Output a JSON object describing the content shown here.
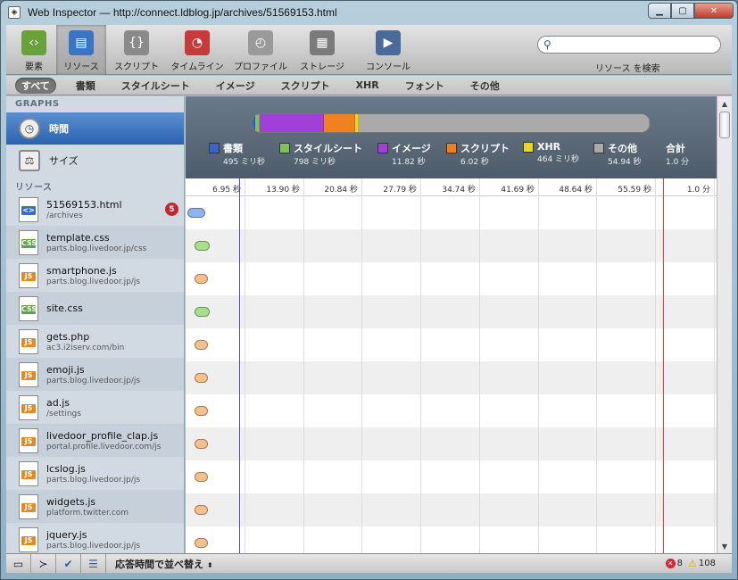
{
  "window": {
    "title": "Web Inspector — http://connect.ldblog.jp/archives/51569153.html"
  },
  "toolbar": {
    "tools": [
      {
        "label": "要素",
        "icon": "elements-icon",
        "color": "#6aa23a"
      },
      {
        "label": "リソース",
        "icon": "resources-icon",
        "color": "#3a74c4"
      },
      {
        "label": "スクリプト",
        "icon": "scripts-icon",
        "color": "#8a8a8a"
      },
      {
        "label": "タイムライン",
        "icon": "timeline-icon",
        "color": "#c83a3a"
      },
      {
        "label": "プロファイル",
        "icon": "profiles-icon",
        "color": "#9a9a9a"
      },
      {
        "label": "ストレージ",
        "icon": "storage-icon",
        "color": "#7a7a7a"
      },
      {
        "label": "コンソール",
        "icon": "console-icon",
        "color": "#4a6a9a"
      }
    ],
    "search_placeholder": "",
    "search_label": "リソース を検索"
  },
  "scopes": [
    "すべて",
    "書類",
    "スタイルシート",
    "イメージ",
    "スクリプト",
    "XHR",
    "フォント",
    "その他"
  ],
  "sidebar": {
    "graphs_header": "GRAPHS",
    "graph_items": [
      "時間",
      "サイズ"
    ],
    "resources_header": "リソース",
    "resources": [
      {
        "name": "51569153.html",
        "sub": "/archives",
        "type": "html",
        "badge": "5"
      },
      {
        "name": "template.css",
        "sub": "parts.blog.livedoor.jp/css",
        "type": "css"
      },
      {
        "name": "smartphone.js",
        "sub": "parts.blog.livedoor.jp/js",
        "type": "js"
      },
      {
        "name": "site.css",
        "sub": "",
        "type": "css"
      },
      {
        "name": "gets.php",
        "sub": "ac3.i2iserv.com/bin",
        "type": "js"
      },
      {
        "name": "emoji.js",
        "sub": "parts.blog.livedoor.jp/js",
        "type": "js"
      },
      {
        "name": "ad.js",
        "sub": "/settings",
        "type": "js"
      },
      {
        "name": "livedoor_profile_clap.js",
        "sub": "portal.profile.livedoor.com/js",
        "type": "js"
      },
      {
        "name": "lcslog.js",
        "sub": "parts.blog.livedoor.jp/js",
        "type": "js"
      },
      {
        "name": "widgets.js",
        "sub": "platform.twitter.com",
        "type": "js"
      },
      {
        "name": "jquery.js",
        "sub": "parts.blog.livedoor.jp/js",
        "type": "js"
      }
    ]
  },
  "type_labels": {
    "html": "<>",
    "css": "CSS",
    "js": "JS"
  },
  "summary": {
    "legend": [
      {
        "name": "書類",
        "value": "495 ミリ秒",
        "color": "#3a64c8"
      },
      {
        "name": "スタイルシート",
        "value": "798 ミリ秒",
        "color": "#7ac45a"
      },
      {
        "name": "イメージ",
        "value": "11.82 秒",
        "color": "#a040d8"
      },
      {
        "name": "スクリプト",
        "value": "6.02 秒",
        "color": "#f08020"
      },
      {
        "name": "XHR",
        "value": "464 ミリ秒",
        "color": "#e8d820"
      },
      {
        "name": "その他",
        "value": "54.94 秒",
        "color": "#aaaaaa"
      },
      {
        "name": "合計",
        "value": "1.0 分",
        "color": ""
      }
    ],
    "bar_fractions": [
      {
        "color": "#3a64c8",
        "fraction": 0.008
      },
      {
        "color": "#7ac45a",
        "fraction": 0.013
      },
      {
        "color": "#a040d8",
        "fraction": 0.16
      },
      {
        "color": "#f08020",
        "fraction": 0.08
      },
      {
        "color": "#e8d820",
        "fraction": 0.008
      },
      {
        "color": "#aaaaaa",
        "fraction": 0.731
      }
    ]
  },
  "ruler": {
    "ticks": [
      "6.95 秒",
      "13.90 秒",
      "20.84 秒",
      "27.79 秒",
      "34.74 秒",
      "41.69 秒",
      "48.64 秒",
      "55.59 秒",
      "1.0 分"
    ]
  },
  "timeline": {
    "total_seconds": 62.5,
    "blue_marker_seconds": 6.3,
    "red_marker_seconds": 56.2,
    "bars": [
      {
        "start_seconds": 0.2,
        "end_seconds": 2.3,
        "color": "#8fb4f0"
      },
      {
        "start_seconds": 1.0,
        "end_seconds": 2.8,
        "color": "#a8e08a"
      },
      {
        "start_seconds": 1.1,
        "end_seconds": 2.6,
        "color": "#f7c08a"
      },
      {
        "start_seconds": 1.1,
        "end_seconds": 2.8,
        "color": "#a8e08a"
      },
      {
        "start_seconds": 1.1,
        "end_seconds": 2.6,
        "color": "#f7c08a"
      },
      {
        "start_seconds": 1.1,
        "end_seconds": 2.6,
        "color": "#f7c08a"
      },
      {
        "start_seconds": 1.1,
        "end_seconds": 2.6,
        "color": "#f7c08a"
      },
      {
        "start_seconds": 1.1,
        "end_seconds": 2.6,
        "color": "#f7c08a"
      },
      {
        "start_seconds": 1.1,
        "end_seconds": 2.6,
        "color": "#f7c08a"
      },
      {
        "start_seconds": 1.1,
        "end_seconds": 2.6,
        "color": "#f7c08a"
      },
      {
        "start_seconds": 1.1,
        "end_seconds": 2.6,
        "color": "#f7c08a"
      }
    ]
  },
  "statusbar": {
    "sort_label": "応答時間で並べ替え",
    "errors": "8",
    "warnings": "108"
  }
}
